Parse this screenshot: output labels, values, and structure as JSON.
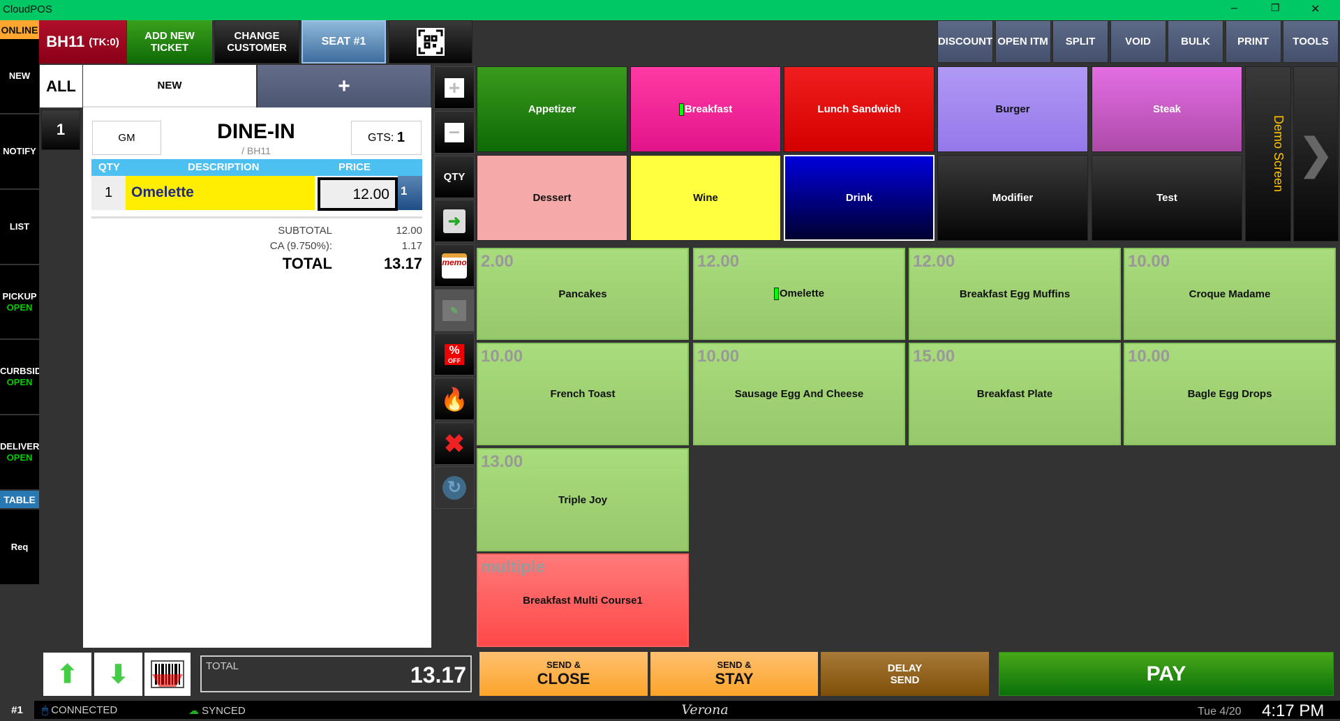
{
  "window": {
    "title": "CloudPOS"
  },
  "nav": {
    "status": "ONLINE",
    "items": [
      {
        "label": "NEW",
        "sub": ""
      },
      {
        "label": "NOTIFY",
        "sub": ""
      },
      {
        "label": "LIST",
        "sub": ""
      },
      {
        "label": "PICKUP",
        "sub": "OPEN"
      },
      {
        "label": "CURBSID",
        "sub": "OPEN"
      },
      {
        "label": "DELIVERY",
        "sub": "OPEN"
      },
      {
        "label": "TABLE",
        "sub": ""
      },
      {
        "label": "Req",
        "sub": ""
      }
    ]
  },
  "top": {
    "ticket": "BH11",
    "ticket_count": "(TK:0)",
    "add_new": "ADD NEW TICKET",
    "change_customer": "CHANGE CUSTOMER",
    "seat": "SEAT #1",
    "right_buttons": [
      "DISCOUNT",
      "OPEN ITM",
      "SPLIT",
      "VOID",
      "BULK",
      "PRINT",
      "TOOLS"
    ]
  },
  "tabs": {
    "all": "ALL",
    "new": "NEW",
    "add": "+",
    "seat_number": "1"
  },
  "ticket": {
    "server": "GM",
    "order_type": "DINE-IN",
    "sub": "/ BH11",
    "guests_label": "GTS:",
    "guests": "1",
    "columns": [
      "QTY",
      "DESCRIPTION",
      "PRICE"
    ],
    "lines": [
      {
        "qty": "1",
        "desc": "Omelette",
        "price": "12.00",
        "seat": "1"
      }
    ],
    "subtotal_label": "SUBTOTAL",
    "subtotal": "12.00",
    "tax_label": "CA (9.750%):",
    "tax": "1.17",
    "total_label": "TOTAL",
    "total": "13.17"
  },
  "tools": [
    "plus-icon",
    "minus-icon",
    "QTY",
    "clipboard-icon",
    "memo-icon",
    "edit-note-icon",
    "percent-off-icon",
    "fire-icon",
    "close-icon",
    "refresh-icon"
  ],
  "tool_labels": {
    "qty": "QTY",
    "percent": "%",
    "off": "OFF",
    "memo": "memo"
  },
  "categories": [
    {
      "label": "Appetizer",
      "bg": "linear-gradient(#3a9a1c,#0e6a06)",
      "fg": "#fff"
    },
    {
      "label": "Breakfast",
      "bg": "linear-gradient(#ff3aa4,#e3148a)",
      "fg": "#fff",
      "selected": true
    },
    {
      "label": "Lunch Sandwich",
      "bg": "linear-gradient(#f01e1e,#d40000)",
      "fg": "#fff"
    },
    {
      "label": "Burger",
      "bg": "linear-gradient(#b09af5,#9478ea)",
      "fg": "#111"
    },
    {
      "label": "Steak",
      "bg": "linear-gradient(#e46ee4,#ad4aa8)",
      "fg": "#fff"
    },
    {
      "label": "Dessert",
      "bg": "#f6a9a9",
      "fg": "#111"
    },
    {
      "label": "Wine",
      "bg": "#ffff40",
      "fg": "#111"
    },
    {
      "label": "Drink",
      "bg": "linear-gradient(#0000dd,#000030)",
      "fg": "#fff"
    },
    {
      "label": "Modifier",
      "bg": "linear-gradient(#3a3a3a,#050505)",
      "fg": "#fff"
    },
    {
      "label": "Test",
      "bg": "linear-gradient(#3a3a3a,#050505)",
      "fg": "#fff"
    }
  ],
  "screen_label": "Demo Screen",
  "items": [
    {
      "price": "2.00",
      "name": "Pancakes"
    },
    {
      "price": "12.00",
      "name": "Omelette",
      "selected": true
    },
    {
      "price": "12.00",
      "name": "Breakfast Egg Muffins"
    },
    {
      "price": "10.00",
      "name": "Croque Madame"
    },
    {
      "price": "10.00",
      "name": "French Toast"
    },
    {
      "price": "10.00",
      "name": "Sausage Egg And Cheese"
    },
    {
      "price": "15.00",
      "name": "Breakfast Plate"
    },
    {
      "price": "10.00",
      "name": "Bagle Egg Drops"
    },
    {
      "price": "13.00",
      "name": "Triple Joy"
    },
    {
      "price": "multiple",
      "name": "Breakfast Multi Course1",
      "red": true
    }
  ],
  "bottom": {
    "total_label": "TOTAL",
    "total": "13.17",
    "send_close_top": "SEND &",
    "send_close": "CLOSE",
    "send_stay_top": "SEND &",
    "send_stay": "STAY",
    "delay_top": "DELAY",
    "delay": "SEND",
    "pay": "PAY"
  },
  "status": {
    "terminal": "#1",
    "connection": "CONNECTED",
    "sync": "SYNCED",
    "location": "Verona",
    "date": "Tue 4/20",
    "time": "4:17 PM"
  }
}
